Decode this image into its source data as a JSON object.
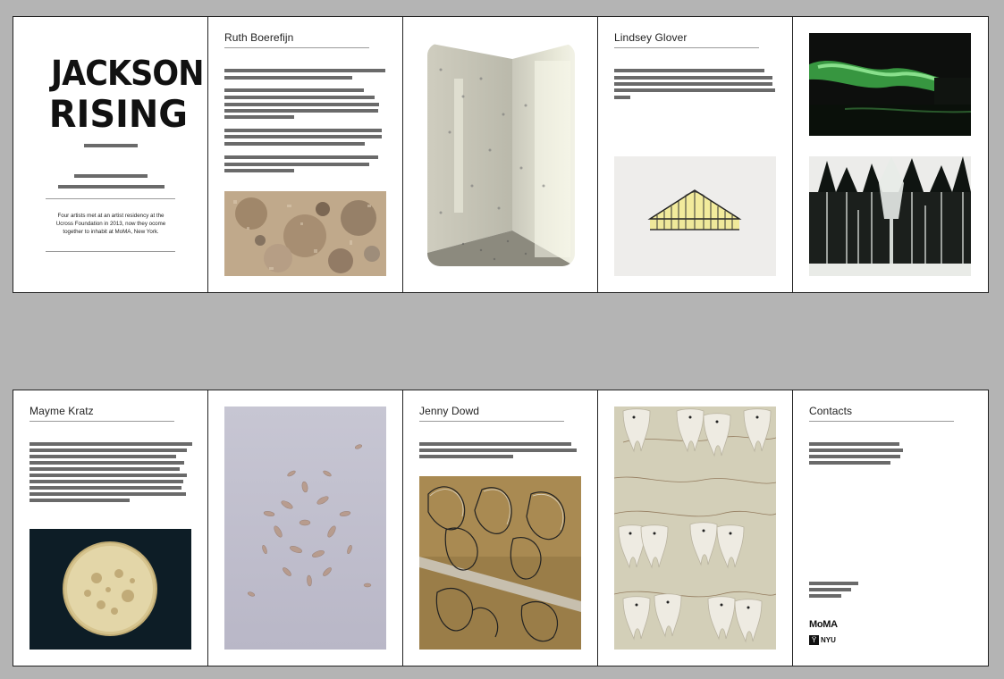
{
  "cover": {
    "title_line1": "JACKSON",
    "title_line2": "RISING",
    "blurb": "Four artists met at an artist residency at the Ucross Foundation in 2013, now they ocome together to inhabit at MoMA, New York."
  },
  "artists": {
    "ruth": "Ruth Boerefijn",
    "lindsey": "Lindsey Glover",
    "mayme": "Mayme Kratz",
    "jenny": "Jenny Dowd"
  },
  "contacts": {
    "heading": "Contacts"
  },
  "logos": {
    "moma": "MoMA",
    "nyu_mark": "Ÿ",
    "nyu": "NYU"
  },
  "images": {
    "ruth": "collage-artwork",
    "room": "installation-room",
    "greenhouse": "greenhouse-illustration",
    "green_light": "green-light-installation",
    "forest": "forest-painting",
    "disc": "resin-disc-artwork",
    "seeds": "seed-pods-artwork",
    "wire": "wire-sculpture",
    "teeth": "teeth-sculpture"
  }
}
